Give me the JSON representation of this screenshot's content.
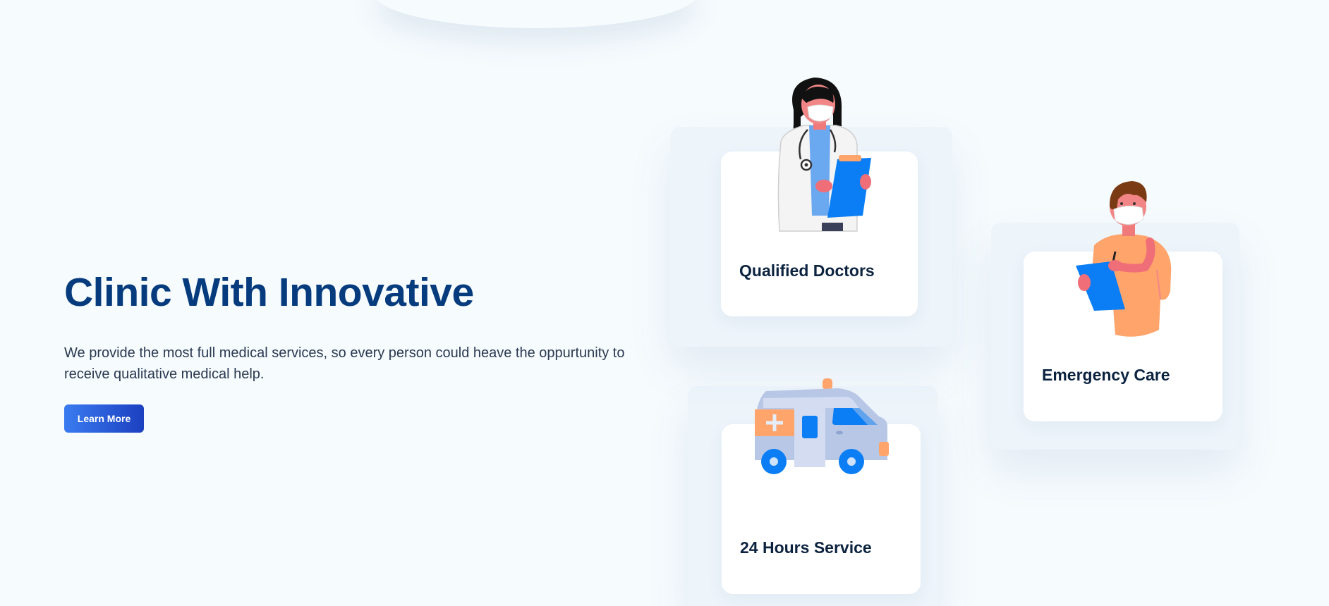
{
  "hero": {
    "title": "Clinic With Innovative",
    "description": "We provide the most full medical services, so every person could heave the oppurtunity to receive qualitative medical help.",
    "cta_label": "Learn More"
  },
  "features": [
    {
      "label": "Qualified Doctors",
      "icon": "doctor-illustration"
    },
    {
      "label": "Emergency Care",
      "icon": "nurse-illustration"
    },
    {
      "label": "24 Hours Service",
      "icon": "ambulance-illustration"
    }
  ],
  "colors": {
    "background": "#f6fbfe",
    "title": "#063c7d",
    "accent_blue": "#0b7ef5",
    "accent_orange": "#ffa46b",
    "button_gradient_start": "#3a7bf0",
    "button_gradient_end": "#1c40c0"
  }
}
